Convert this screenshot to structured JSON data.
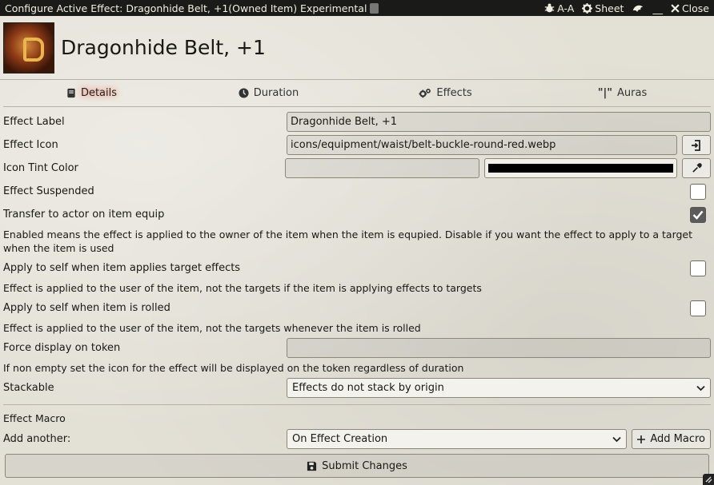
{
  "window": {
    "title": "Configure Active Effect: Dragonhide Belt, +1(Owned Item) Experimental",
    "controls": {
      "a_a": "A-A",
      "sheet": "Sheet",
      "minimize": "__",
      "close": "Close"
    }
  },
  "header": {
    "name": "Dragonhide Belt, +1"
  },
  "tabs": [
    {
      "label": "Details",
      "icon": "book-icon",
      "active": true
    },
    {
      "label": "Duration",
      "icon": "clock-icon",
      "active": false
    },
    {
      "label": "Effects",
      "icon": "cogs-icon",
      "active": false
    },
    {
      "label": "Auras",
      "icon": "aura-icon",
      "active": false
    }
  ],
  "form": {
    "effect_label": {
      "label": "Effect Label",
      "value": "Dragonhide Belt, +1"
    },
    "effect_icon": {
      "label": "Effect Icon",
      "value": "icons/equipment/waist/belt-buckle-round-red.webp"
    },
    "icon_tint": {
      "label": "Icon Tint Color",
      "value": "",
      "color": "#000000"
    },
    "suspended": {
      "label": "Effect Suspended",
      "checked": false
    },
    "transfer": {
      "label": "Transfer to actor on item equip",
      "checked": true,
      "note": "Enabled means the effect is applied to the owner of the item when the item is equpied. Disable if you want the effect to apply to a target when the item is used"
    },
    "apply_self_target": {
      "label": "Apply to self when item applies target effects",
      "checked": false,
      "note": "Effect is applied to the user of the item, not the targets if the item is applying effects to targets"
    },
    "apply_self_rolled": {
      "label": "Apply to self when item is rolled",
      "checked": false,
      "note": "Effect is applied to the user of the item, not the targets whenever the item is rolled"
    },
    "force_display": {
      "label": "Force display on token",
      "value": "",
      "note": "If non empty set the icon for the effect will be displayed on the token regardless of duration"
    },
    "stackable": {
      "label": "Stackable",
      "value": "Effects do not stack by origin"
    },
    "macro": {
      "label": "Effect Macro",
      "add_label": "Add another:",
      "select_value": "On Effect Creation",
      "add_button": "Add Macro"
    },
    "submit": "Submit Changes"
  }
}
